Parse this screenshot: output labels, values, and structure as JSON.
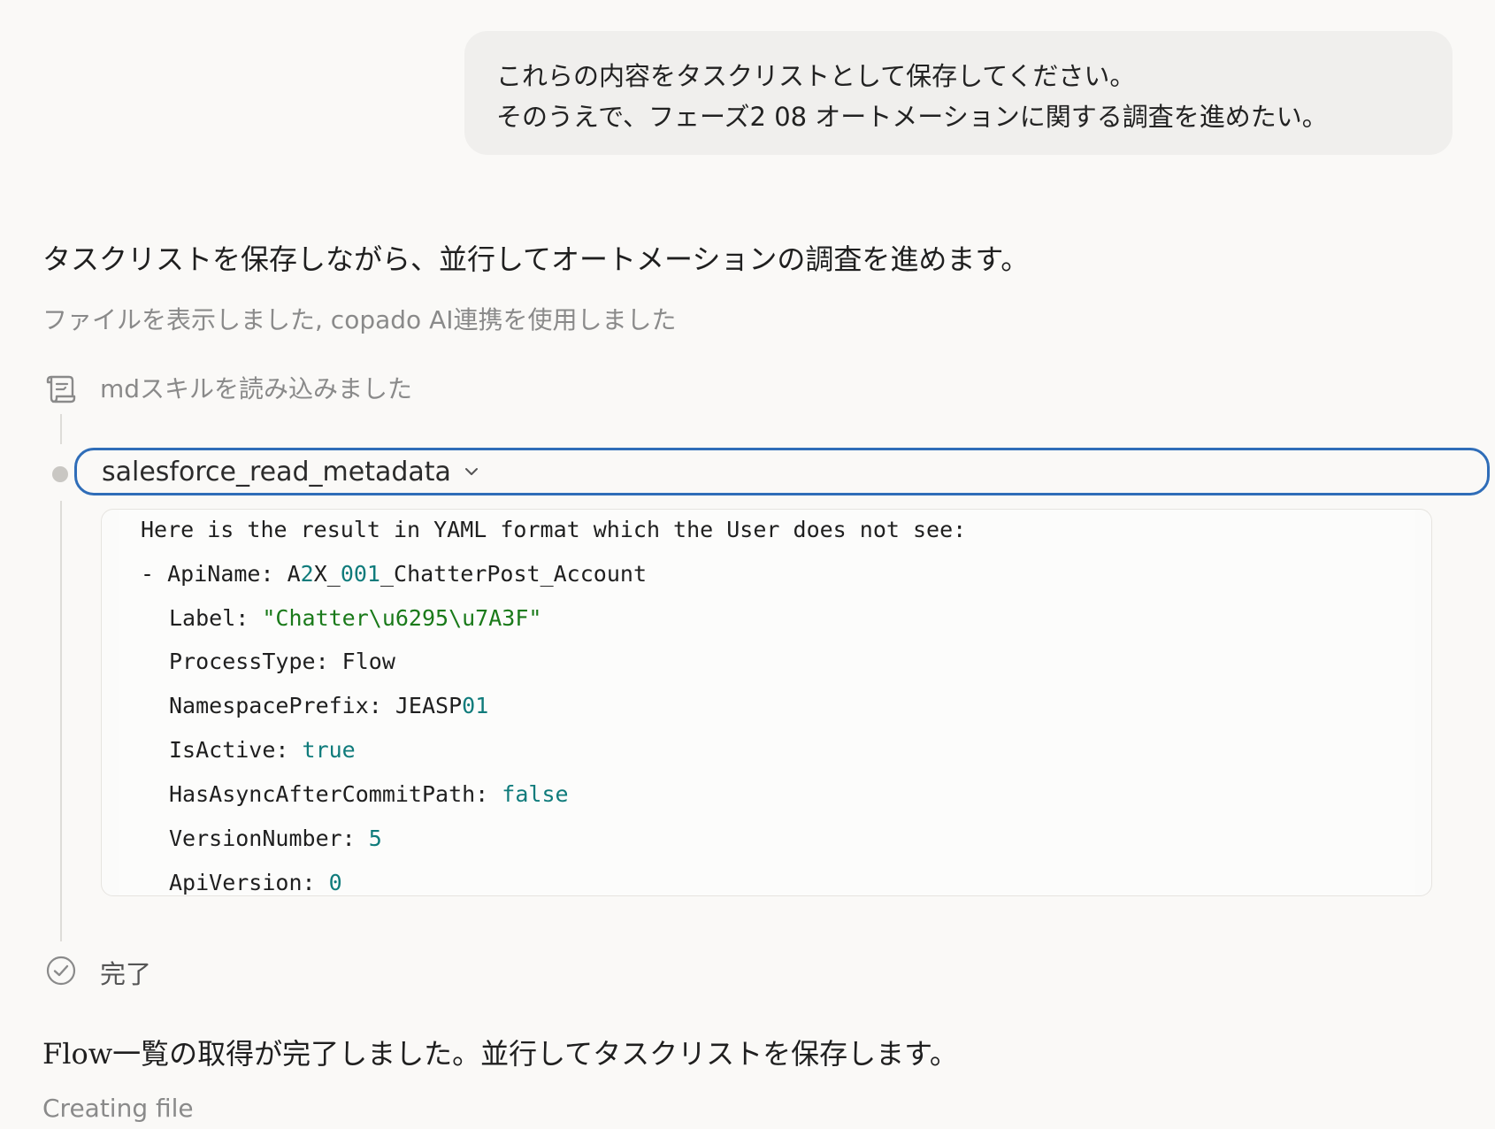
{
  "user_message": {
    "line1": "これらの内容をタスクリストとして保存してください。",
    "line2": "そのうえで、フェーズ2 08 オートメーションに関する調査を進めたい。"
  },
  "assistant": {
    "intro": "タスクリストを保存しながら、並行してオートメーションの調査を進めます。",
    "activity_summary": "ファイルを表示しました, copado AI連携を使用しました",
    "skill_loaded": "mdスキルを読み込みました",
    "tool_name": "salesforce_read_metadata",
    "result": {
      "header": "Here is the result in YAML format which the User does not see:",
      "item_prefix": "- ",
      "api_name_key": "ApiName: ",
      "api_name_parts": [
        "A",
        "2",
        "X_",
        "001",
        "_ChatterPost_Account"
      ],
      "label_key": "Label: ",
      "label_value": "\"Chatter\\u6295\\u7A3F\"",
      "process_type_key": "ProcessType: ",
      "process_type_value": "Flow",
      "namespace_key": "NamespacePrefix: ",
      "namespace_value_parts": [
        "JEASP",
        "01"
      ],
      "is_active_key": "IsActive: ",
      "is_active_value": "true",
      "async_key": "HasAsyncAfterCommitPath: ",
      "async_value": "false",
      "version_key": "VersionNumber: ",
      "version_value": "5",
      "api_version_key": "ApiVersion: ",
      "api_version_value": "0"
    },
    "done_label": "完了",
    "followup": "Flow一覧の取得が完了しました。並行してタスクリストを保存します。",
    "status": "Creating file"
  },
  "colors": {
    "accent_border": "#2f6db8",
    "code_number": "#0f7b7b",
    "code_string": "#1a7a1a"
  },
  "icons": [
    "scroll-icon",
    "chevron-down-icon",
    "check-circle-icon"
  ]
}
